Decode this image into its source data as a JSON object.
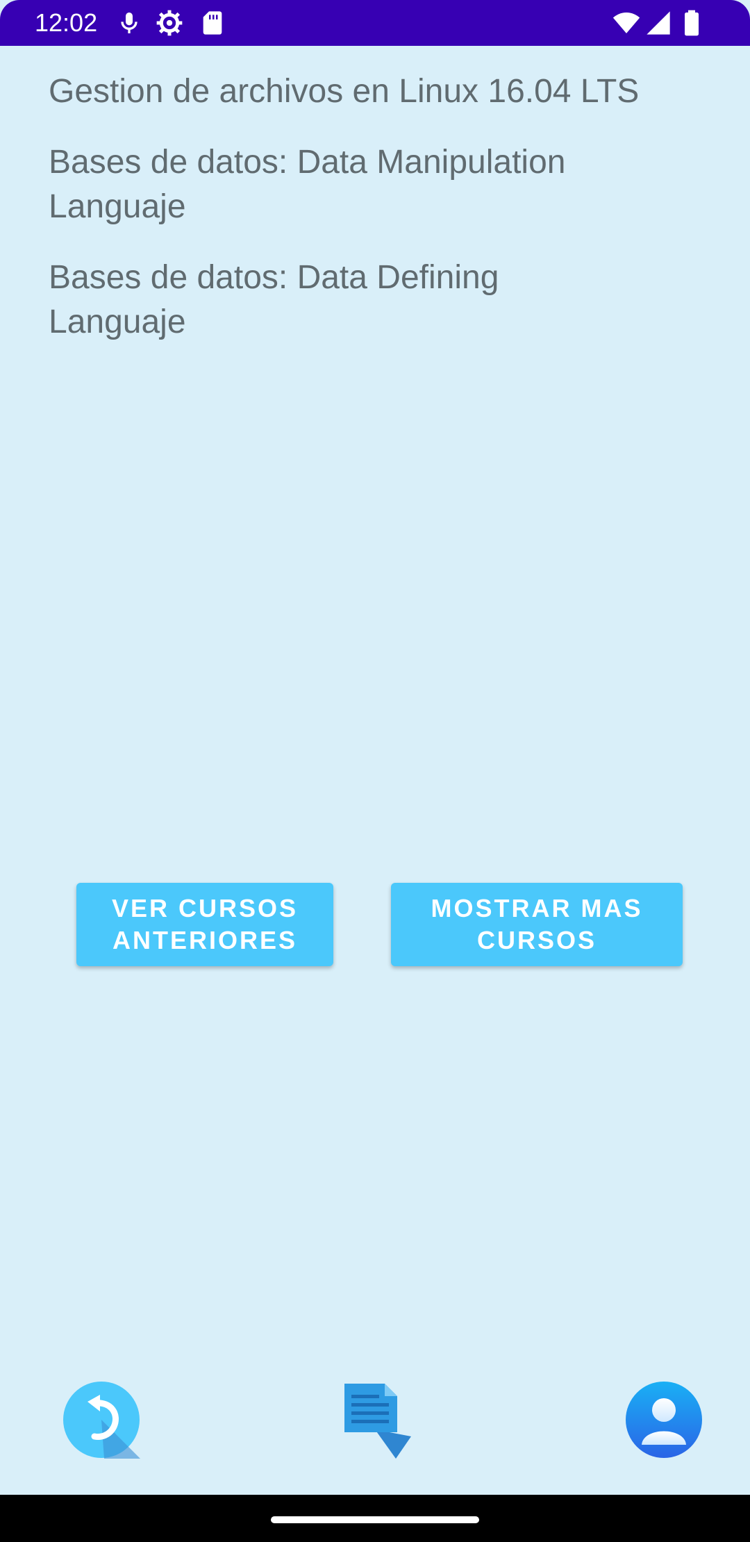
{
  "status_bar": {
    "time": "12:02",
    "icons": [
      "mic-icon",
      "settings-icon",
      "sd-card-icon",
      "wifi-icon",
      "signal-icon",
      "battery-icon"
    ],
    "color": "#3700b3"
  },
  "courses": [
    {
      "label": "Gestion de archivos en Linux 16.04 LTS"
    },
    {
      "label": "Bases de datos: Data Manipulation Languaje"
    },
    {
      "label": "Bases de datos: Data Defining Languaje"
    }
  ],
  "buttons": {
    "previous_courses": "VER CURSOS ANTERIORES",
    "more_courses": "MOSTRAR MAS CURSOS",
    "color": "#4bc8fb"
  },
  "bottom_nav": {
    "icons": [
      "back-icon",
      "notes-icon",
      "user-profile-icon"
    ]
  },
  "colors": {
    "background": "#d9eff9",
    "text": "#606b70"
  }
}
